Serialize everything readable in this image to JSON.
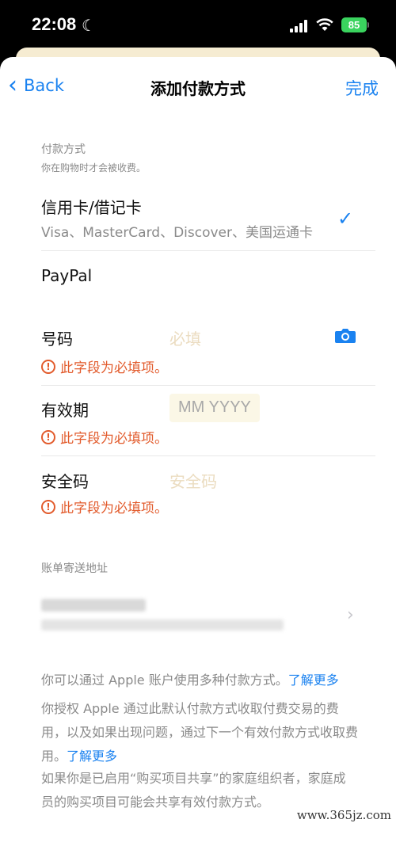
{
  "status_bar": {
    "time": "22:08",
    "battery": "85"
  },
  "nav": {
    "back_label": "Back",
    "title": "添加付款方式",
    "done_label": "完成"
  },
  "payment": {
    "section_title": "付款方式",
    "section_subtitle": "你在购物时才会被收费。",
    "card_title": "信用卡/借记卡",
    "card_subtitle": "Visa、MasterCard、Discover、美国运通卡",
    "paypal_title": "PayPal"
  },
  "fields": {
    "number_label": "号码",
    "number_placeholder": "必填",
    "expiry_label": "有效期",
    "expiry_placeholder": "MM YYYY",
    "cvv_label": "安全码",
    "cvv_placeholder": "安全码",
    "error_text": "此字段为必填项。"
  },
  "billing": {
    "section_title": "账单寄送地址"
  },
  "footer": {
    "p1": "你可以通过 Apple 账户使用多种付款方式。",
    "p1_link": "了解更多",
    "p2": "你授权 Apple 通过此默认付款方式收取付费交易的费用，以及如果出现问题，通过下一个有效付款方式收取费用。",
    "p2_link": "了解更多",
    "p3": "如果你是已启用“购买项目共享”的家庭组织者，家庭成员的购买项目可能会共享有效付款方式。"
  },
  "watermark": "www.365jz.com",
  "colors": {
    "accent": "#1a82f0",
    "error": "#e25b2c"
  }
}
